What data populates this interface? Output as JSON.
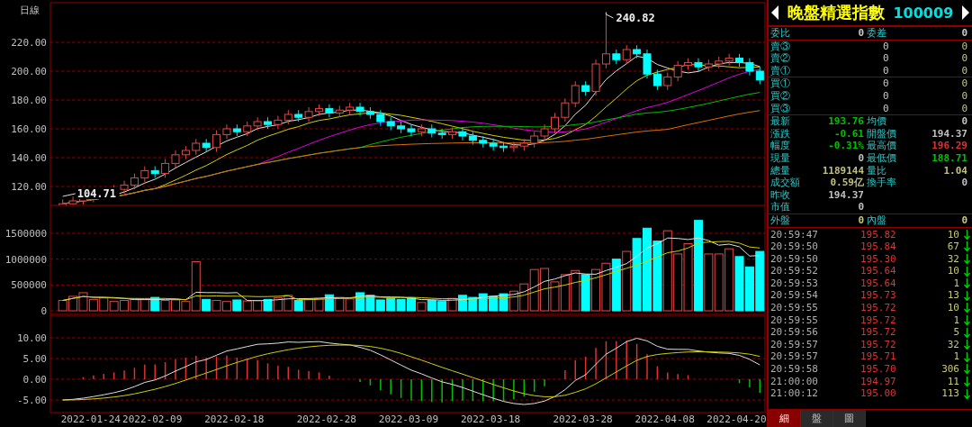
{
  "price_chart": {
    "period": "日線",
    "axis_labels": [
      "220.00",
      "200.00",
      "180.00",
      "160.00",
      "140.00",
      "120.00"
    ],
    "annotations": [
      "240.82",
      "104.71"
    ]
  },
  "volume_chart": {
    "axis_labels": [
      "1500000",
      "1000000",
      "500000",
      "0"
    ]
  },
  "macd_chart": {
    "axis_labels": [
      "10.00",
      "5.00",
      "0.00",
      "-5.00"
    ],
    "dates": [
      "2022-01-24",
      "2022-02-09",
      "2022-02-18",
      "2022-02-28",
      "2022-03-09",
      "2022-03-18",
      "2022-03-28",
      "2022-04-08",
      "2022-04-20"
    ]
  },
  "quote": {
    "name": "晚盤精選指數",
    "code": "100009",
    "order_ratio": {
      "label": "委比",
      "value": "0"
    },
    "order_diff": {
      "label": "委差",
      "value": "0"
    },
    "asks": [
      {
        "label": "賣③",
        "price": "0",
        "volume": "0"
      },
      {
        "label": "賣②",
        "price": "0",
        "volume": "0"
      },
      {
        "label": "賣①",
        "price": "0",
        "volume": "0"
      }
    ],
    "bids": [
      {
        "label": "買①",
        "price": "0",
        "volume": "0"
      },
      {
        "label": "買②",
        "price": "0",
        "volume": "0"
      },
      {
        "label": "買③",
        "price": "0",
        "volume": "0"
      }
    ],
    "stats": [
      {
        "left": {
          "label": "最新",
          "value": "193.76",
          "color": "#00c000"
        },
        "right": {
          "label": "均價",
          "value": "0",
          "color": "#c0c0c0"
        }
      },
      {
        "left": {
          "label": "漲跌",
          "value": "-0.61",
          "color": "#00c000"
        },
        "right": {
          "label": "開盤價",
          "value": "194.37",
          "color": "#c0c0c0"
        }
      },
      {
        "left": {
          "label": "幅度",
          "value": "-0.31%",
          "color": "#00c000"
        },
        "right": {
          "label": "最高價",
          "value": "196.29",
          "color": "#e03030"
        }
      },
      {
        "left": {
          "label": "現量",
          "value": "0",
          "color": "#c0c0c0"
        },
        "right": {
          "label": "最低價",
          "value": "188.71",
          "color": "#00c000"
        }
      },
      {
        "left": {
          "label": "總量",
          "value": "1189144",
          "color": "#c0c080"
        },
        "right": {
          "label": "量比",
          "value": "1.04",
          "color": "#c0c080"
        }
      },
      {
        "left": {
          "label": "成交額",
          "value": "0.59亿",
          "color": "#c0c080"
        },
        "right": {
          "label": "換手率",
          "value": "0",
          "color": "#c0c0c0"
        }
      },
      {
        "left": {
          "label": "昨收",
          "value": "194.37",
          "color": "#c0c0c0"
        }
      },
      {
        "left": {
          "label": "市值",
          "value": "0",
          "color": "#c0c0c0"
        }
      }
    ],
    "outer": {
      "label": "外盤",
      "value": "0"
    },
    "inner": {
      "label": "內盤",
      "value": "0"
    },
    "trades": [
      {
        "time": "20:59:47",
        "price": "195.82",
        "volume": "10"
      },
      {
        "time": "20:59:50",
        "price": "195.84",
        "volume": "67"
      },
      {
        "time": "20:59:50",
        "price": "195.30",
        "volume": "32"
      },
      {
        "time": "20:59:52",
        "price": "195.64",
        "volume": "10"
      },
      {
        "time": "20:59:53",
        "price": "195.64",
        "volume": "1"
      },
      {
        "time": "20:59:54",
        "price": "195.73",
        "volume": "13"
      },
      {
        "time": "20:59:55",
        "price": "195.72",
        "volume": "10"
      },
      {
        "time": "20:59:55",
        "price": "195.72",
        "volume": "1"
      },
      {
        "time": "20:59:56",
        "price": "195.72",
        "volume": "5"
      },
      {
        "time": "20:59:57",
        "price": "195.72",
        "volume": "32"
      },
      {
        "time": "20:59:57",
        "price": "195.71",
        "volume": "1"
      },
      {
        "time": "20:59:58",
        "price": "195.70",
        "volume": "306"
      },
      {
        "time": "21:00:00",
        "price": "194.97",
        "volume": "11"
      },
      {
        "time": "21:00:12",
        "price": "195.00",
        "volume": "113"
      }
    ],
    "tabs": [
      {
        "label": "細",
        "selected": true
      },
      {
        "label": "盤",
        "selected": false
      },
      {
        "label": "圖",
        "selected": false
      }
    ]
  }
}
